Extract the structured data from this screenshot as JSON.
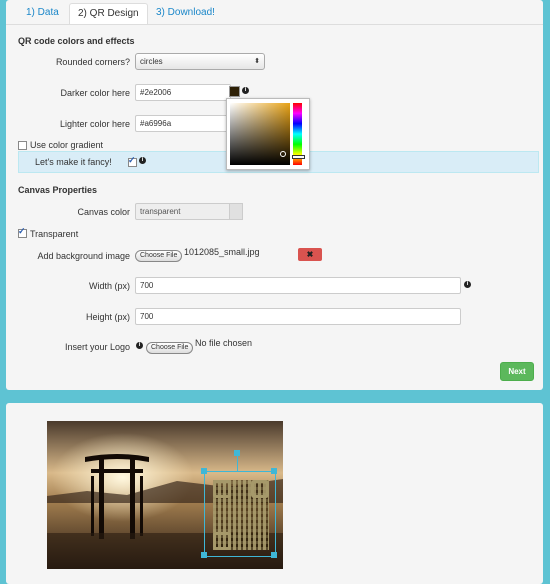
{
  "tabs": [
    {
      "label": "1) Data"
    },
    {
      "label": "2) QR Design"
    },
    {
      "label": "3) Download!"
    }
  ],
  "qr_section": {
    "title": "QR code colors and effects",
    "rounded_label": "Rounded corners?",
    "rounded_value": "circles",
    "darker_label": "Darker color here",
    "darker_value": "#2e2006",
    "lighter_label": "Lighter color here",
    "lighter_value": "#a6996a",
    "gradient_label": "Use color gradient",
    "fancy_label": "Let's make it fancy!"
  },
  "canvas_section": {
    "title": "Canvas Properties",
    "color_label": "Canvas color",
    "color_value": "transparent",
    "transparent_label": "Transparent",
    "bg_label": "Add background image",
    "choose_file": "Choose File",
    "bg_file": "1012085_small.jpg",
    "width_label": "Width (px)",
    "width_value": "700",
    "height_label": "Height (px)",
    "height_value": "700",
    "logo_label": "Insert your Logo",
    "logo_file": "No file chosen"
  },
  "next_label": "Next",
  "colors": {
    "darker": "#2e2006",
    "lighter": "#a6996a",
    "next": "#5cb85c",
    "delete": "#d9534f"
  },
  "icons": [
    "info-icon",
    "close-icon",
    "checkbox-icon"
  ]
}
